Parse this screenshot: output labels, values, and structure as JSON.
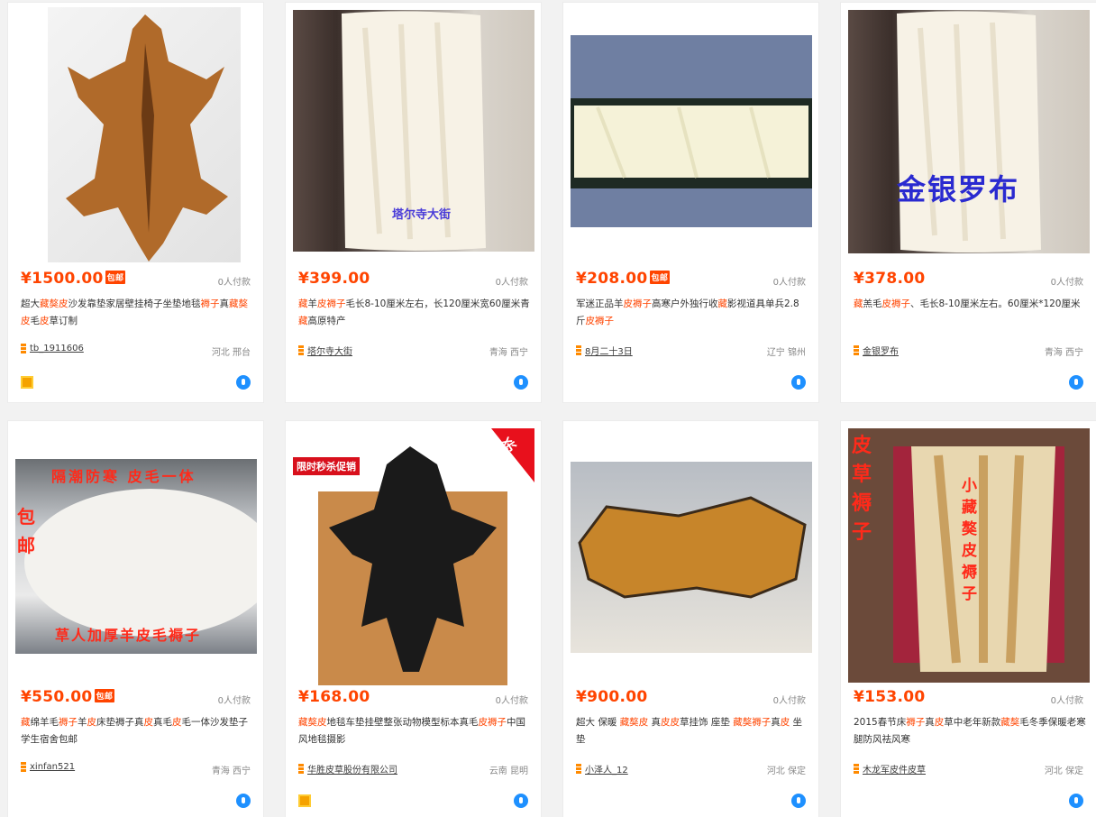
{
  "products": [
    {
      "price": "¥1500.00",
      "badge": "包邮",
      "sales": "0人付款",
      "title_parts": [
        {
          "text": "超大",
          "hl": false
        },
        {
          "text": "藏獒",
          "hl": true
        },
        {
          "text": "皮",
          "hl": true
        },
        {
          "text": "沙发靠垫家居壁挂椅子坐垫地毯",
          "hl": false
        },
        {
          "text": "褥子",
          "hl": true
        },
        {
          "text": "真",
          "hl": false
        },
        {
          "text": "藏獒",
          "hl": true
        },
        {
          "text": "皮",
          "hl": true
        },
        {
          "text": "毛",
          "hl": false
        },
        {
          "text": "皮",
          "hl": true
        },
        {
          "text": "草订制",
          "hl": false
        }
      ],
      "shop": "tb_1911606",
      "location": "河北 邢台",
      "gold_badge": true,
      "image": "brown-dog-pelt"
    },
    {
      "price": "¥399.00",
      "badge": "",
      "sales": "0人付款",
      "title_parts": [
        {
          "text": "藏",
          "hl": true
        },
        {
          "text": "羊",
          "hl": false
        },
        {
          "text": "皮褥子",
          "hl": true
        },
        {
          "text": "毛长8-10厘米左右，长120厘米宽60厘米青",
          "hl": false
        },
        {
          "text": "藏",
          "hl": true
        },
        {
          "text": "高原特产",
          "hl": false
        }
      ],
      "shop": "塔尔寺大街",
      "location": "青海 西宁",
      "gold_badge": false,
      "image": "white-sheepskin",
      "overlay_text": "塔尔寺大街"
    },
    {
      "price": "¥208.00",
      "badge": "包邮",
      "sales": "0人付款",
      "title_parts": [
        {
          "text": "军迷正品羊",
          "hl": false
        },
        {
          "text": "皮褥子",
          "hl": true
        },
        {
          "text": "高寒户外独行收",
          "hl": false
        },
        {
          "text": "藏",
          "hl": true
        },
        {
          "text": "影视道具单兵2.8斤",
          "hl": false
        },
        {
          "text": "皮褥子",
          "hl": true
        }
      ],
      "shop": "8月二十3日",
      "location": "辽宁 锦州",
      "gold_badge": false,
      "image": "military-mat"
    },
    {
      "price": "¥378.00",
      "badge": "",
      "sales": "0人付款",
      "title_parts": [
        {
          "text": "藏",
          "hl": true
        },
        {
          "text": "羔毛",
          "hl": false
        },
        {
          "text": "皮褥子",
          "hl": true
        },
        {
          "text": "、毛长8-10厘米左右。60厘米*120厘米",
          "hl": false
        }
      ],
      "shop": "金银罗布",
      "location": "青海 西宁",
      "gold_badge": false,
      "image": "white-sheepskin-2",
      "overlay_text": "金银罗布"
    },
    {
      "price": "¥550.00",
      "badge": "包邮",
      "sales": "0人付款",
      "title_parts": [
        {
          "text": "藏",
          "hl": true
        },
        {
          "text": "绵羊毛",
          "hl": false
        },
        {
          "text": "褥子",
          "hl": true
        },
        {
          "text": "羊",
          "hl": false
        },
        {
          "text": "皮",
          "hl": true
        },
        {
          "text": "床垫褥子真",
          "hl": false
        },
        {
          "text": "皮",
          "hl": true
        },
        {
          "text": "真毛",
          "hl": false
        },
        {
          "text": "皮",
          "hl": true
        },
        {
          "text": "毛一体沙发垫子学生宿舍包邮",
          "hl": false
        }
      ],
      "shop": "xinfan521",
      "location": "青海 西宁",
      "gold_badge": false,
      "image": "white-fluffy-mat",
      "overlay_top": "隔潮防寒 皮毛一体",
      "overlay_side": "包邮",
      "overlay_bottom": "草人加厚羊皮毛褥子"
    },
    {
      "price": "¥168.00",
      "badge": "",
      "sales": "0人付款",
      "title_parts": [
        {
          "text": "藏獒",
          "hl": true
        },
        {
          "text": "皮",
          "hl": true
        },
        {
          "text": "地毯车垫挂壁整张动物模型标本真毛",
          "hl": false
        },
        {
          "text": "皮褥子",
          "hl": true
        },
        {
          "text": "中国风地毯摄影",
          "hl": false
        }
      ],
      "shop": "华胜皮草股份有限公司",
      "location": "云南 昆明",
      "gold_badge": true,
      "image": "black-pelt",
      "promo_label": "限时秒杀促销",
      "flash_label": "秒杀"
    },
    {
      "price": "¥900.00",
      "badge": "",
      "sales": "0人付款",
      "title_parts": [
        {
          "text": "超大 保暖 ",
          "hl": false
        },
        {
          "text": "藏獒",
          "hl": true
        },
        {
          "text": "皮",
          "hl": true
        },
        {
          "text": " 真",
          "hl": false
        },
        {
          "text": "皮",
          "hl": true
        },
        {
          "text": "皮",
          "hl": true
        },
        {
          "text": "草挂饰 座垫 ",
          "hl": false
        },
        {
          "text": "藏獒",
          "hl": true
        },
        {
          "text": "褥子",
          "hl": true
        },
        {
          "text": "真",
          "hl": false
        },
        {
          "text": "皮",
          "hl": true
        },
        {
          "text": " 坐垫",
          "hl": false
        }
      ],
      "shop": "小泽人_12",
      "location": "河北 保定",
      "gold_badge": false,
      "image": "tan-pelt"
    },
    {
      "price": "¥153.00",
      "badge": "",
      "sales": "0人付款",
      "title_parts": [
        {
          "text": "2015春节床",
          "hl": false
        },
        {
          "text": "褥子",
          "hl": true
        },
        {
          "text": "真",
          "hl": false
        },
        {
          "text": "皮",
          "hl": true
        },
        {
          "text": "草中老年新款",
          "hl": false
        },
        {
          "text": "藏獒",
          "hl": true
        },
        {
          "text": "毛冬季保暖老寒腿防风祛风寒",
          "hl": false
        }
      ],
      "shop": "木龙军皮件皮草",
      "location": "河北 保定",
      "gold_badge": false,
      "image": "patchwork-mat",
      "overlay_left": "皮草褥子",
      "overlay_center": "小藏獒皮褥子"
    }
  ],
  "colors": {
    "price": "#ff4400",
    "highlight": "#ff4400",
    "wangwang": "#1e90ff"
  }
}
